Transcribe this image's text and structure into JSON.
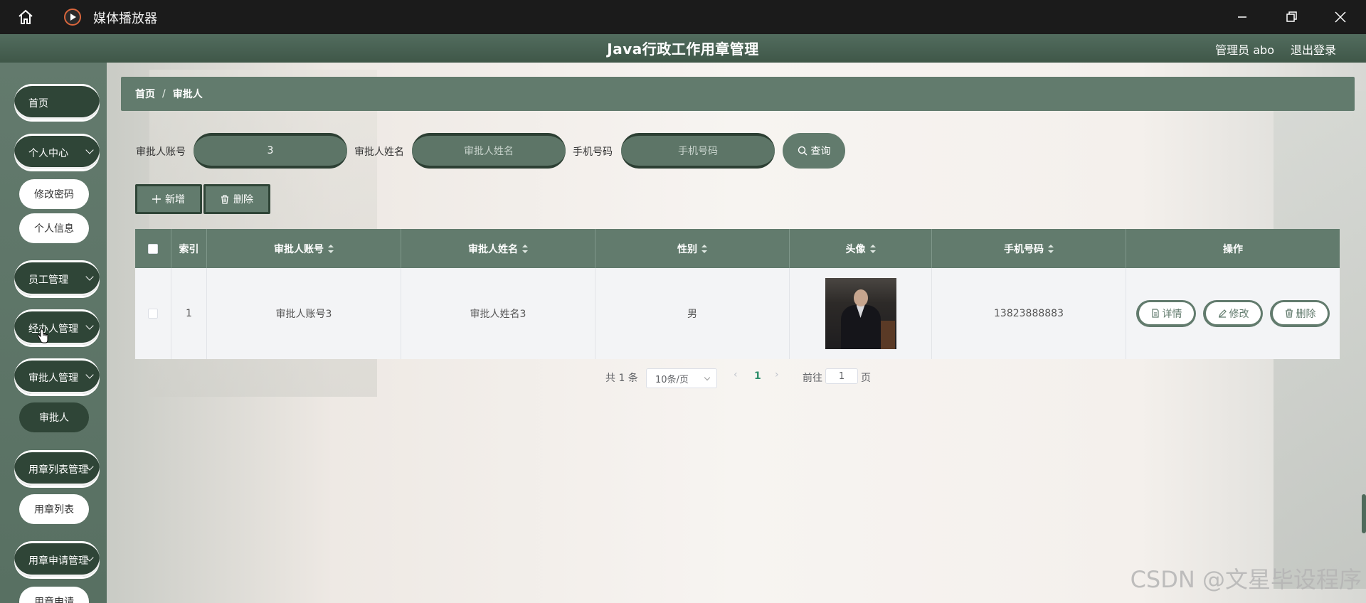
{
  "player": {
    "title": "媒体播放器",
    "icons": [
      "home-icon",
      "play-icon",
      "minimize-icon",
      "restore-icon",
      "close-icon"
    ]
  },
  "header": {
    "title": "Java行政工作用章管理",
    "admin": "管理员 abo",
    "logout": "退出登录"
  },
  "sidebar": {
    "home": "首页",
    "personal_center": "个人中心",
    "change_password": "修改密码",
    "personal_info": "个人信息",
    "employee_mgmt": "员工管理",
    "handler_mgmt": "经办人管理",
    "approver_mgmt": "审批人管理",
    "approver": "审批人",
    "seal_list_mgmt": "用章列表管理",
    "seal_list": "用章列表",
    "seal_apply_mgmt": "用章申请管理",
    "seal_apply": "用章申请"
  },
  "breadcrumb": {
    "home": "首页",
    "separator": "/",
    "current": "审批人"
  },
  "search": {
    "account_label": "审批人账号",
    "account_value": "3",
    "name_label": "审批人姓名",
    "name_placeholder": "审批人姓名",
    "phone_label": "手机号码",
    "phone_placeholder": "手机号码",
    "query": "查询"
  },
  "actions": {
    "add": "新增",
    "delete": "删除"
  },
  "table": {
    "headers": [
      "索引",
      "审批人账号",
      "审批人姓名",
      "性别",
      "头像",
      "手机号码",
      "操作"
    ],
    "rows": [
      {
        "index": "1",
        "account": "审批人账号3",
        "name": "审批人姓名3",
        "gender": "男",
        "phone": "13823888883"
      }
    ],
    "ops": {
      "detail": "详情",
      "edit": "修改",
      "delete": "删除"
    }
  },
  "pagination": {
    "total": "共 1 条",
    "page_size": "10条/页",
    "current": "1",
    "goto_label": "前往",
    "goto_value": "1",
    "page_unit": "页"
  },
  "watermark": "CSDN @文星毕设程序",
  "colors": {
    "primary": "#627b6d",
    "dark": "#2f4537",
    "titlebar": "#1b1b1b"
  }
}
